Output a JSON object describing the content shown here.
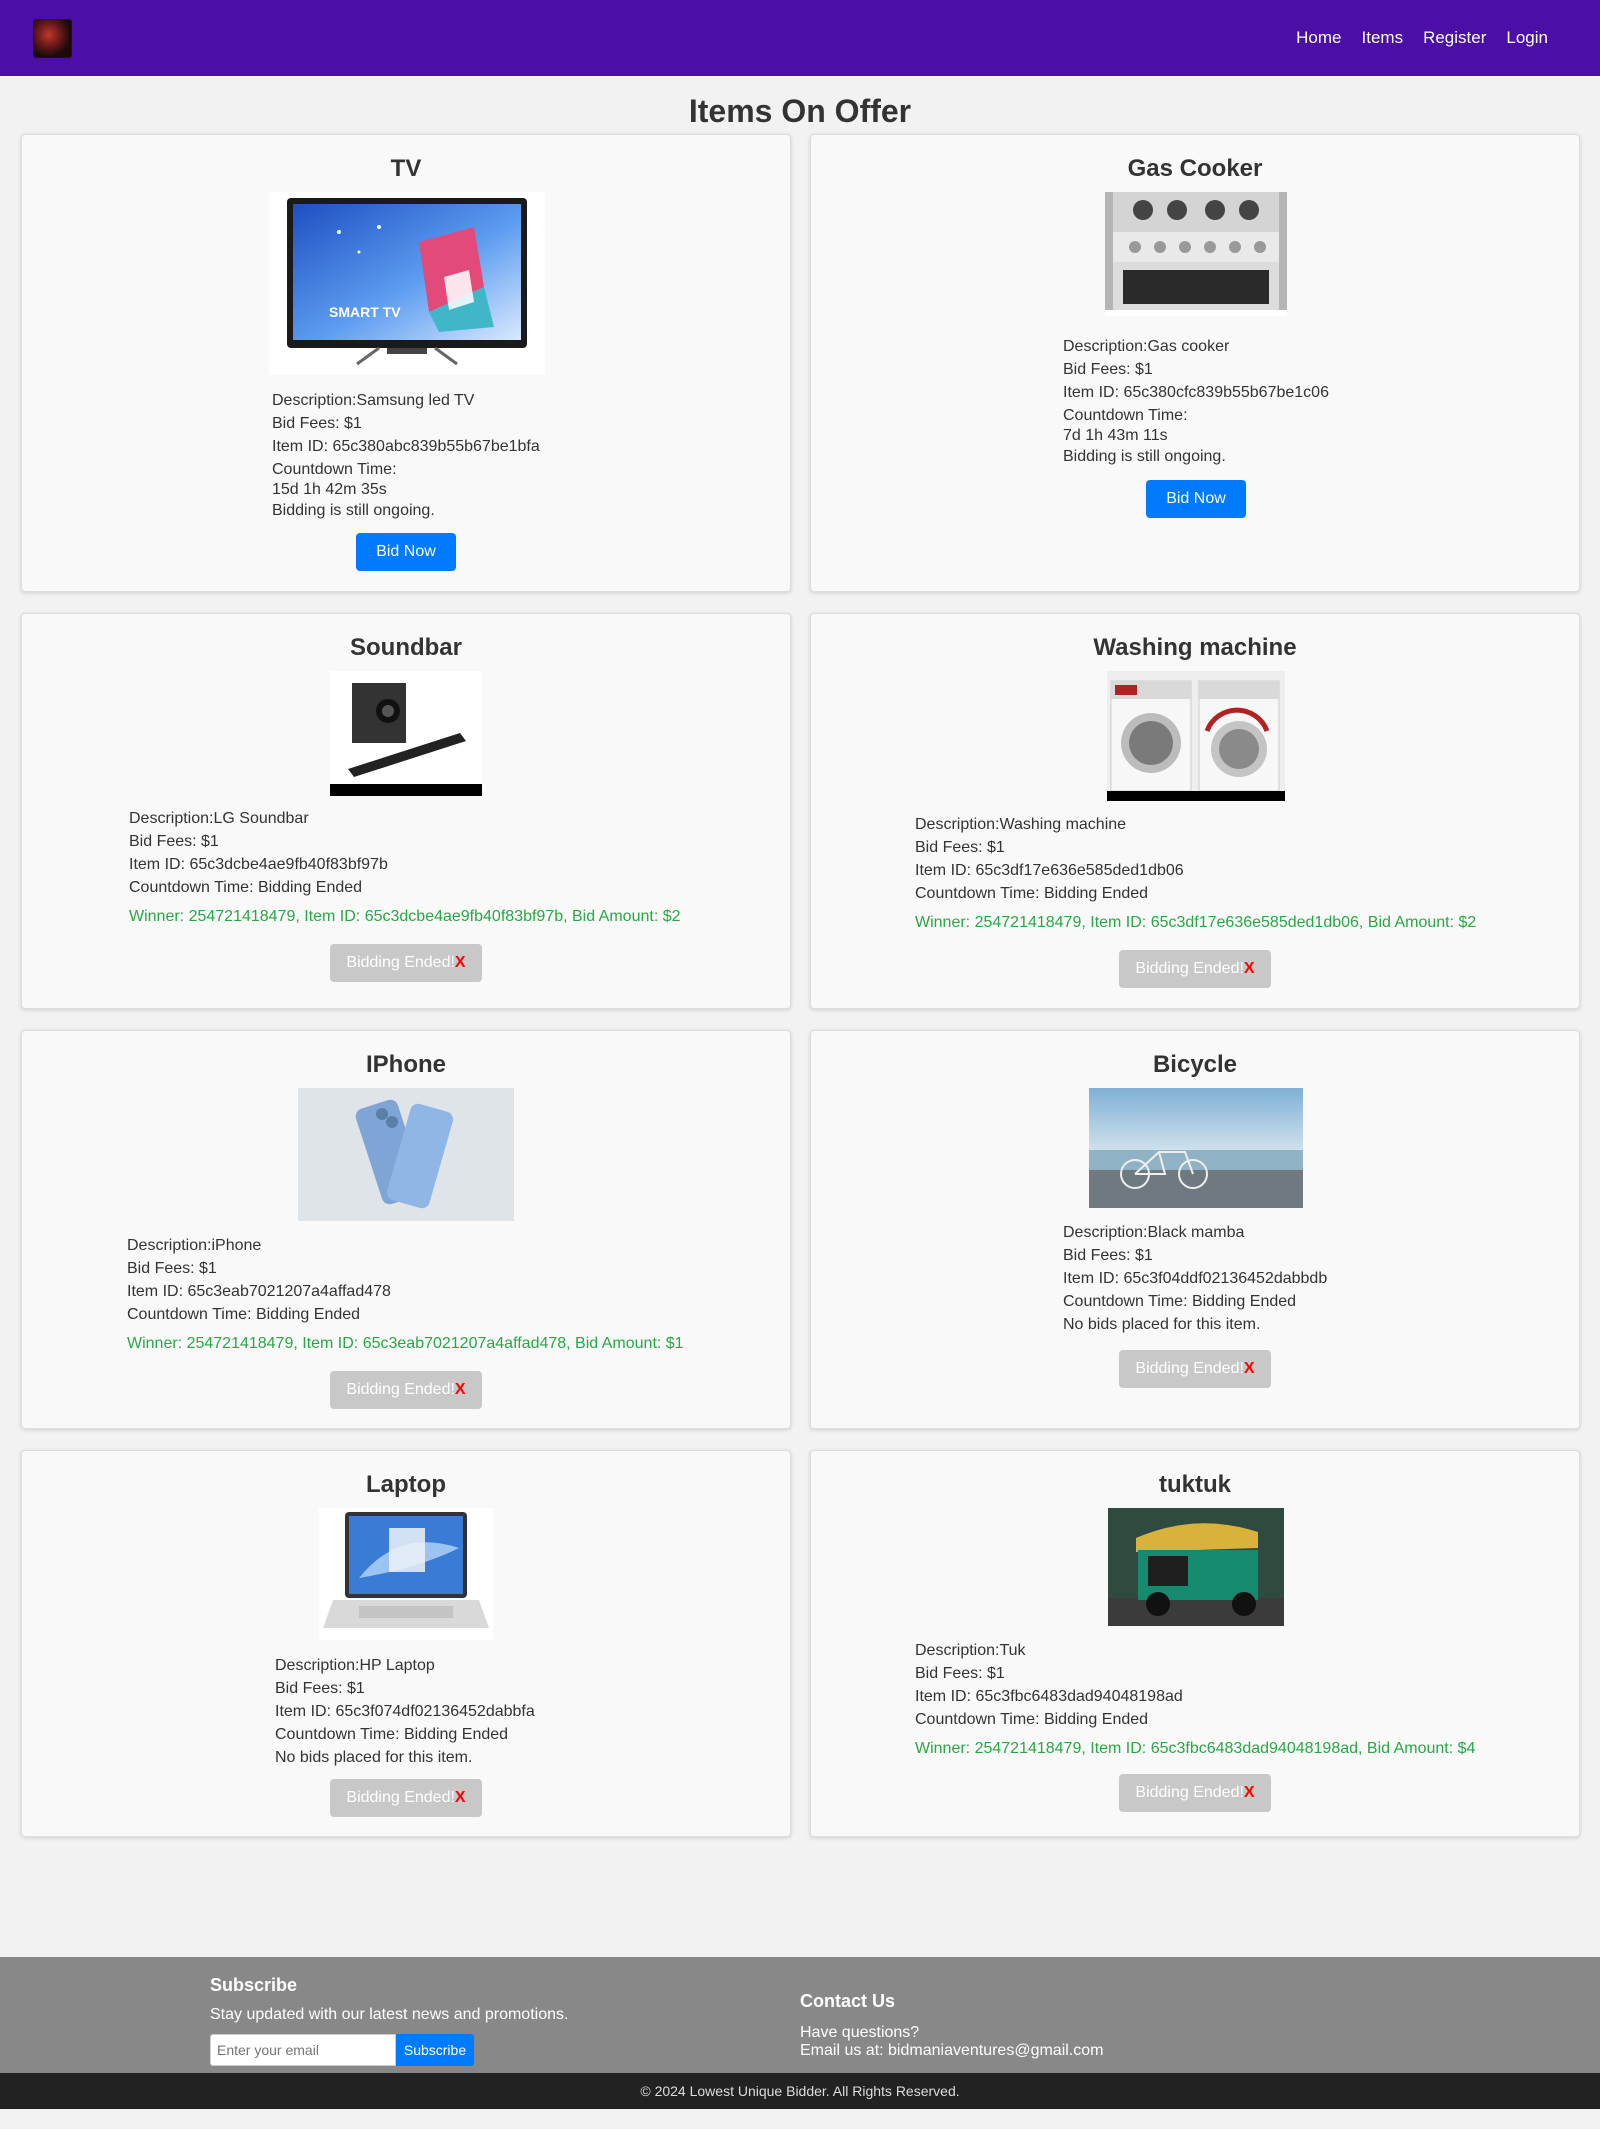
{
  "nav": {
    "links": [
      "Home",
      "Items",
      "Register",
      "Login"
    ]
  },
  "page_title": "Items On Offer",
  "items": [
    {
      "title": "TV",
      "description": "Description:Samsung led TV",
      "bid_fees": "Bid Fees: $1",
      "item_id": "Item ID: 65c380abc839b55b67be1bfa",
      "countdown_label": "Countdown Time:",
      "countdown_value": "15d 1h 42m 35s",
      "status": "Bidding is still ongoing.",
      "button": "Bid Now"
    },
    {
      "title": "Gas Cooker",
      "description": "Description:Gas cooker",
      "bid_fees": "Bid Fees: $1",
      "item_id": "Item ID: 65c380cfc839b55b67be1c06",
      "countdown_label": "Countdown Time:",
      "countdown_value": "7d 1h 43m 11s",
      "status": "Bidding is still ongoing.",
      "button": "Bid Now"
    },
    {
      "title": "Soundbar",
      "description": "Description:LG Soundbar",
      "bid_fees": "Bid Fees: $1",
      "item_id": "Item ID: 65c3dcbe4ae9fb40f83bf97b",
      "countdown": "Countdown Time: Bidding Ended",
      "winner": "Winner: 254721418479, Item ID: 65c3dcbe4ae9fb40f83bf97b, Bid Amount: $2",
      "button": "Bidding Ended!",
      "button_x": "X"
    },
    {
      "title": "Washing machine",
      "description": "Description:Washing machine",
      "bid_fees": "Bid Fees: $1",
      "item_id": "Item ID: 65c3df17e636e585ded1db06",
      "countdown": "Countdown Time: Bidding Ended",
      "winner": "Winner: 254721418479, Item ID: 65c3df17e636e585ded1db06, Bid Amount: $2",
      "button": "Bidding Ended!",
      "button_x": "X"
    },
    {
      "title": "IPhone",
      "description": "Description:iPhone",
      "bid_fees": "Bid Fees: $1",
      "item_id": "Item ID: 65c3eab7021207a4affad478",
      "countdown": "Countdown Time: Bidding Ended",
      "winner": "Winner: 254721418479, Item ID: 65c3eab7021207a4affad478, Bid Amount: $1",
      "button": "Bidding Ended!",
      "button_x": "X"
    },
    {
      "title": "Bicycle",
      "description": "Description:Black mamba",
      "bid_fees": "Bid Fees: $1",
      "item_id": "Item ID: 65c3f04ddf02136452dabbdb",
      "countdown": "Countdown Time: Bidding Ended",
      "status": "No bids placed for this item.",
      "button": "Bidding Ended!",
      "button_x": "X"
    },
    {
      "title": "Laptop",
      "description": "Description:HP Laptop",
      "bid_fees": "Bid Fees: $1",
      "item_id": "Item ID: 65c3f074df02136452dabbfa",
      "countdown": "Countdown Time: Bidding Ended",
      "status": "No bids placed for this item.",
      "button": "Bidding Ended!",
      "button_x": "X"
    },
    {
      "title": "tuktuk",
      "description": "Description:Tuk",
      "bid_fees": "Bid Fees: $1",
      "item_id": "Item ID: 65c3fbc6483dad94048198ad",
      "countdown": "Countdown Time: Bidding Ended",
      "winner": "Winner: 254721418479, Item ID: 65c3fbc6483dad94048198ad, Bid Amount: $4",
      "button": "Bidding Ended!",
      "button_x": "X"
    }
  ],
  "footer": {
    "subscribe_title": "Subscribe",
    "subscribe_text": "Stay updated with our latest news and promotions.",
    "email_placeholder": "Enter your email",
    "subscribe_button": "Subscribe",
    "contact_title": "Contact Us",
    "contact_question": "Have questions?",
    "contact_email": "Email us at: bidmaniaventures@gmail.com",
    "copyright": "© 2024 Lowest Unique Bidder. All Rights Reserved."
  },
  "colors": {
    "navbar": "#4b0fa8",
    "primary_button": "#007bff",
    "ended_button": "#c8c8c8",
    "winner_text": "#28a745",
    "footer": "#888888",
    "copyright_bar": "#222222"
  }
}
